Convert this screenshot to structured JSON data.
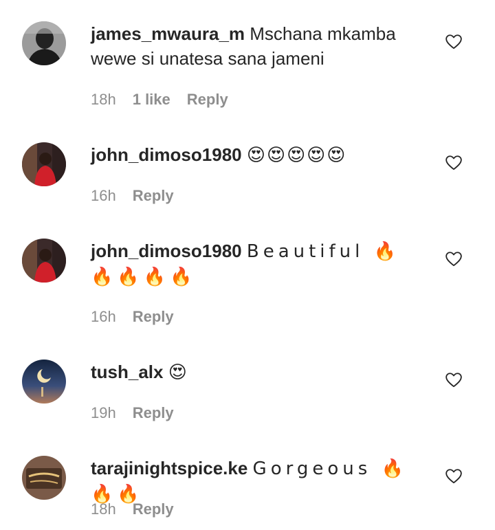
{
  "colors": {
    "text": "#262626",
    "muted": "#8e8e8e",
    "background": "#ffffff"
  },
  "comments": [
    {
      "username": "james_mwaura_m",
      "text": "Mschana mkamba wewe si unatesa sana jameni",
      "time": "18h",
      "likes": "1 like",
      "reply": "Reply",
      "avatar": "james-avatar"
    },
    {
      "username": "john_dimoso1980",
      "text": "😍😍😍😍😍",
      "time": "16h",
      "likes": "",
      "reply": "Reply",
      "avatar": "john-avatar"
    },
    {
      "username": "john_dimoso1980",
      "text": "Beautiful 🔥🔥🔥🔥🔥",
      "time": "16h",
      "likes": "",
      "reply": "Reply",
      "avatar": "john-avatar"
    },
    {
      "username": "tush_alx",
      "text": "😍",
      "time": "19h",
      "likes": "",
      "reply": "Reply",
      "avatar": "moon-avatar"
    },
    {
      "username": "tarajinightspice.ke",
      "text": "Gorgeous 🔥🔥🔥",
      "time": "18h",
      "likes": "",
      "reply": "Reply",
      "avatar": "nightspice-logo-avatar"
    }
  ],
  "icons": {
    "like": "heart-outline-icon"
  }
}
